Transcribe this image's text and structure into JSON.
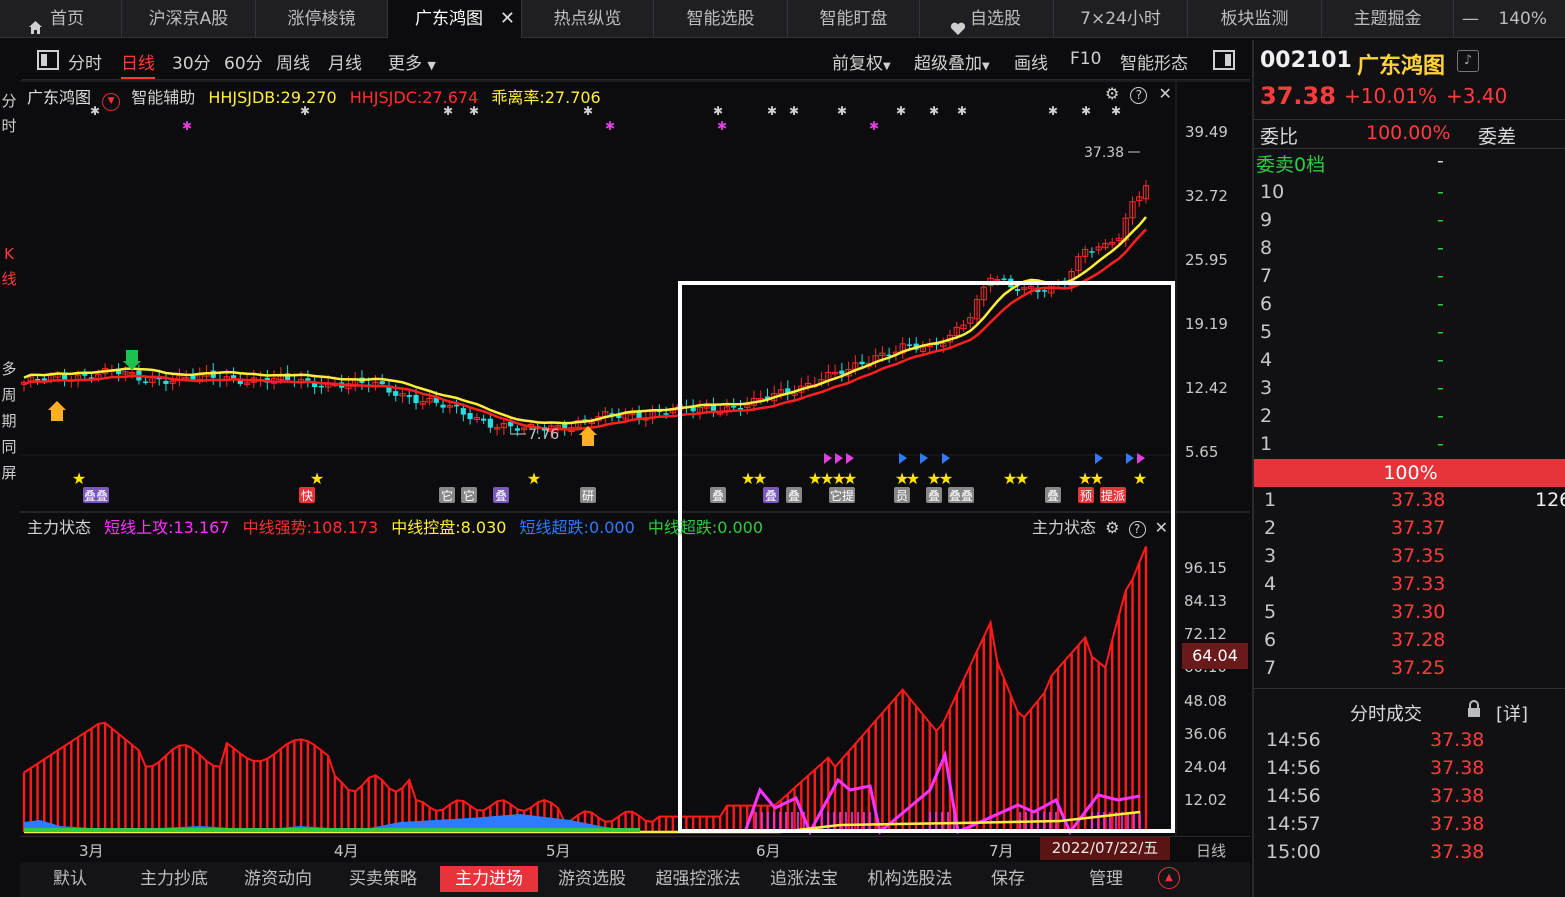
{
  "tabs": [
    {
      "label": "首页",
      "icon": "home-icon"
    },
    {
      "label": "沪深京A股"
    },
    {
      "label": "涨停棱镜"
    },
    {
      "label": "广东鸿图",
      "active": true
    },
    {
      "label": "热点纵览"
    },
    {
      "label": "智能选股"
    },
    {
      "label": "智能盯盘"
    },
    {
      "label": "自选股",
      "icon": "heart-icon"
    },
    {
      "label": "7×24小时"
    },
    {
      "label": "板块监测"
    },
    {
      "label": "主题掘金"
    }
  ],
  "zoom": "140%",
  "zoom_minus": "—",
  "toolbar": {
    "periods": [
      "分时",
      "日线",
      "30分",
      "60分",
      "周线",
      "月线"
    ],
    "active_period": "日线",
    "more": "更多",
    "right": [
      "前复权",
      "超级叠加",
      "画线",
      "F10",
      "智能形态"
    ]
  },
  "left_strip": [
    "分",
    "时",
    "K",
    "线",
    "多",
    "周",
    "期",
    "同",
    "屏"
  ],
  "main_chart": {
    "name": "广东鸿图",
    "indicator": "智能辅助",
    "items": [
      {
        "label": "HHJSJDB:29.270",
        "color": "#ffef3a"
      },
      {
        "label": "HHJSJDC:27.674",
        "color": "#ff3030"
      },
      {
        "label": "乖离率:27.706",
        "color": "#ffef3a"
      }
    ],
    "y_ticks": [
      "39.49",
      "32.72",
      "25.95",
      "19.19",
      "12.42",
      "5.65"
    ],
    "high_label": "37.38",
    "low_label": "7.76"
  },
  "sub_chart": {
    "title": "主力状态",
    "items": [
      {
        "label": "短线上攻:13.167",
        "color": "#ff33ff"
      },
      {
        "label": "中线强势:108.173",
        "color": "#ff3030"
      },
      {
        "label": "中线控盘:8.030",
        "color": "#ffef3a"
      },
      {
        "label": "短线超跌:0.000",
        "color": "#2e7bff"
      },
      {
        "label": "中线超跌:0.000",
        "color": "#2ecc40"
      }
    ],
    "y_ticks": [
      "96.15",
      "84.13",
      "72.12",
      "60.10",
      "48.08",
      "36.06",
      "24.04",
      "12.02"
    ],
    "current_value": "64.04"
  },
  "x_axis": {
    "months": [
      "3月",
      "4月",
      "5月",
      "6月",
      "7月"
    ],
    "date": "2022/07/22/五",
    "period": "日线"
  },
  "markers": [
    "叠叠",
    "快",
    "它",
    "它",
    "叠",
    "研",
    "叠",
    "叠",
    "叠",
    "它提",
    "员",
    "叠",
    "叠叠",
    "叠",
    "预",
    "提派"
  ],
  "bottom_tabs": [
    "默认",
    "主力抄底",
    "游资动向",
    "买卖策略",
    "主力进场",
    "游资选股",
    "超强控涨法",
    "追涨法宝",
    "机构选股法",
    "保存",
    "管理"
  ],
  "active_bottom_tab": "主力进场",
  "quote": {
    "code": "002101",
    "name": "广东鸿图",
    "price": "37.38",
    "pct": "+10.01%",
    "chg": "+3.40",
    "weibi_label": "委比",
    "weibi": "100.00%",
    "weicha_label": "委差",
    "sell_label": "委卖0档",
    "sell_value": "-",
    "sell_levels": [
      "10",
      "9",
      "8",
      "7",
      "6",
      "5",
      "4",
      "3",
      "2",
      "1"
    ],
    "sell_level_value": "-",
    "ratio_bar": "100%",
    "buy_levels": [
      {
        "n": "1",
        "price": "37.38",
        "vol": "126"
      },
      {
        "n": "2",
        "price": "37.37",
        "vol": ""
      },
      {
        "n": "3",
        "price": "37.35",
        "vol": ""
      },
      {
        "n": "4",
        "price": "37.33",
        "vol": ""
      },
      {
        "n": "5",
        "price": "37.30",
        "vol": ""
      },
      {
        "n": "6",
        "price": "37.28",
        "vol": ""
      },
      {
        "n": "7",
        "price": "37.25",
        "vol": ""
      }
    ],
    "trades_title": "分时成交",
    "trades_detail": "[详]",
    "trades": [
      {
        "time": "14:56",
        "price": "37.38"
      },
      {
        "time": "14:56",
        "price": "37.38"
      },
      {
        "time": "14:56",
        "price": "37.38"
      },
      {
        "time": "14:57",
        "price": "37.38"
      },
      {
        "time": "15:00",
        "price": "37.38"
      }
    ]
  },
  "colors": {
    "up": "#ff2a2a",
    "down": "#22e0e0",
    "ma1": "#ffef3a",
    "ma2": "#ff2020",
    "accent": "#e8333a"
  }
}
